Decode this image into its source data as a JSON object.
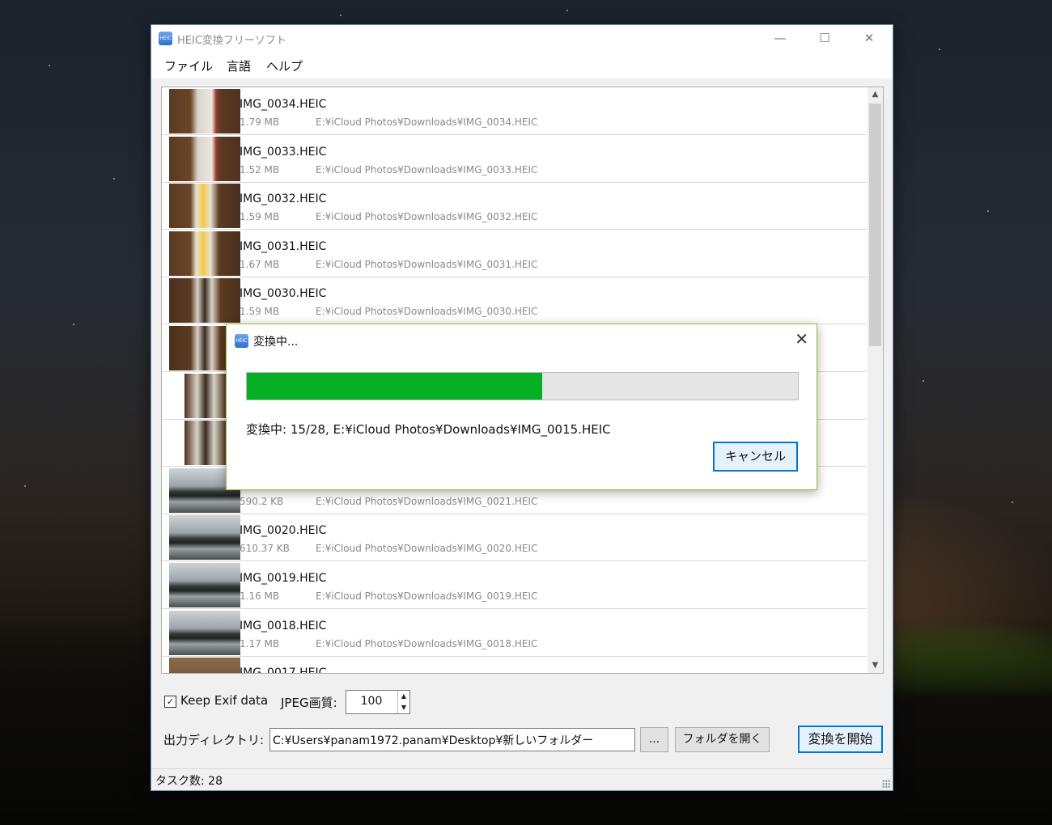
{
  "window": {
    "title": "HEIC変換フリーソフト",
    "controls": {
      "minimize": "—",
      "maximize": "☐",
      "close": "✕"
    }
  },
  "menu": [
    "ファイル",
    "言語",
    "ヘルプ"
  ],
  "files": [
    {
      "name": "IMG_0034.HEIC",
      "size": "1.79 MB",
      "path": "E:¥iCloud Photos¥Downloads¥IMG_0034.HEIC",
      "thumb": "tool"
    },
    {
      "name": "IMG_0033.HEIC",
      "size": "1.52 MB",
      "path": "E:¥iCloud Photos¥Downloads¥IMG_0033.HEIC",
      "thumb": "tool"
    },
    {
      "name": "IMG_0032.HEIC",
      "size": "1.59 MB",
      "path": "E:¥iCloud Photos¥Downloads¥IMG_0032.HEIC",
      "thumb": "package"
    },
    {
      "name": "IMG_0031.HEIC",
      "size": "1.67 MB",
      "path": "E:¥iCloud Photos¥Downloads¥IMG_0031.HEIC",
      "thumb": "package"
    },
    {
      "name": "IMG_0030.HEIC",
      "size": "1.59 MB",
      "path": "E:¥iCloud Photos¥Downloads¥IMG_0030.HEIC",
      "thumb": "scissors"
    },
    {
      "name": "",
      "size": "",
      "path": "",
      "thumb": "scissors"
    },
    {
      "name": "",
      "size": "",
      "path": "",
      "thumb": "scissors-narrow"
    },
    {
      "name": "",
      "size": "",
      "path": "",
      "thumb": "scissors-narrow"
    },
    {
      "name": "",
      "size": "590.2 KB",
      "path": "E:¥iCloud Photos¥Downloads¥IMG_0021.HEIC",
      "thumb": "lake"
    },
    {
      "name": "IMG_0020.HEIC",
      "size": "610.37 KB",
      "path": "E:¥iCloud Photos¥Downloads¥IMG_0020.HEIC",
      "thumb": "lake"
    },
    {
      "name": "IMG_0019.HEIC",
      "size": "1.16 MB",
      "path": "E:¥iCloud Photos¥Downloads¥IMG_0019.HEIC",
      "thumb": "lake"
    },
    {
      "name": "IMG_0018.HEIC",
      "size": "1.17 MB",
      "path": "E:¥iCloud Photos¥Downloads¥IMG_0018.HEIC",
      "thumb": "lake"
    },
    {
      "name": "IMG_0017.HEIC",
      "size": "",
      "path": "",
      "thumb": "box"
    }
  ],
  "options": {
    "keep_exif_label": "Keep Exif data",
    "keep_exif_checked": true,
    "jpeg_quality_label": "JPEG画質:",
    "jpeg_quality": "100"
  },
  "output": {
    "label": "出力ディレクトリ:",
    "path": "C:¥Users¥panam1972.panam¥Desktop¥新しいフォルダー",
    "browse_label": "...",
    "open_folder_label": "フォルダを開く",
    "start_label": "変換を開始"
  },
  "status": {
    "tasks": "タスク数: 28"
  },
  "dialog": {
    "title": "変換中...",
    "progress_fraction": 0.5357,
    "message": "変換中: 15/28, E:¥iCloud Photos¥Downloads¥IMG_0015.HEIC",
    "cancel_label": "キャンセル"
  },
  "colors": {
    "progress_fill": "#06b025",
    "accent": "#0078d7",
    "dialog_border": "#8fc33a"
  }
}
